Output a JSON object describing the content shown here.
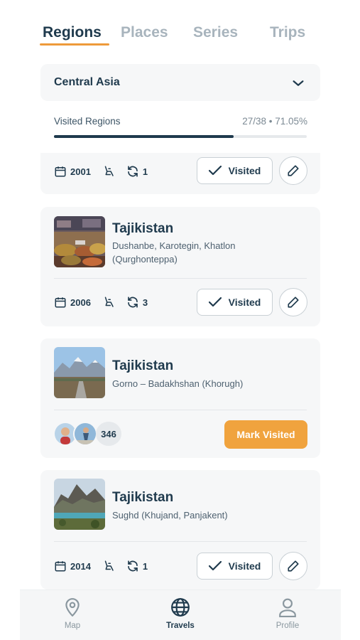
{
  "tabs": [
    {
      "label": "Regions",
      "active": true
    },
    {
      "label": "Places",
      "active": false
    },
    {
      "label": "Series",
      "active": false
    },
    {
      "label": "Trips",
      "active": false
    }
  ],
  "filter": {
    "region": "Central Asia",
    "icon": "chevron-down-icon"
  },
  "progress": {
    "label": "Visited Regions",
    "summary": "27/38 • 71.05%",
    "visited": 27,
    "total": 38,
    "fraction": 0.7105
  },
  "colors": {
    "accent": "#ee9a3a",
    "primary": "#1f3a4d",
    "card_bg": "#f6f7f8",
    "mark_button": "#f0a33e"
  },
  "partial_card": {
    "year": "2001",
    "visits": "1",
    "visited_label": "Visited"
  },
  "cards": [
    {
      "title": "Tajikistan",
      "subtitle": "Dushanbe, Karotegin, Khatlon (Qurghonteppa)",
      "year": "2006",
      "visits": "3",
      "visited_label": "Visited",
      "image": "market-photo"
    },
    {
      "title": "Tajikistan",
      "subtitle": "Gorno – Badakhshan (Khorugh)",
      "visitor_count": "346",
      "mark_label": "Mark Visited",
      "image": "mountain-road-photo"
    },
    {
      "title": "Tajikistan",
      "subtitle": "Sughd (Khujand, Panjakent)",
      "year": "2014",
      "visits": "1",
      "visited_label": "Visited",
      "image": "lake-mountain-photo"
    }
  ],
  "nav": [
    {
      "label": "Map",
      "icon": "map-pin-icon",
      "active": false
    },
    {
      "label": "Travels",
      "icon": "globe-icon",
      "active": true
    },
    {
      "label": "Profile",
      "icon": "user-icon",
      "active": false
    }
  ]
}
